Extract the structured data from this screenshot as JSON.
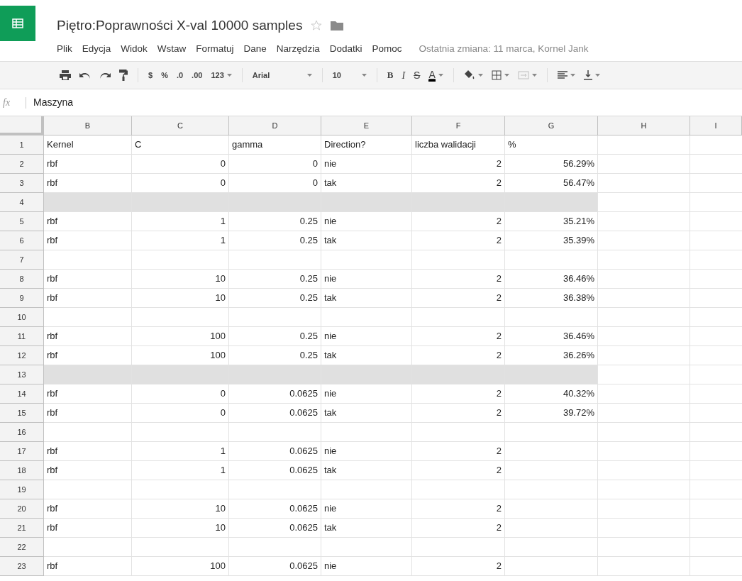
{
  "title": "Piętro:Poprawności X-val 10000 samples",
  "starred": false,
  "menu": [
    "Plik",
    "Edycja",
    "Widok",
    "Wstaw",
    "Formatuj",
    "Dane",
    "Narzędzia",
    "Dodatki",
    "Pomoc"
  ],
  "last_edit": "Ostatnia zmiana: 11 marca, Kornel Jank",
  "toolbar": {
    "currency": "$",
    "percent": "%",
    "decrease_decimals": ".0",
    "increase_decimals": ".00",
    "number_format": "123",
    "font": "Arial",
    "font_size": "10",
    "bold": "B",
    "italic": "I",
    "strikethrough": "S",
    "text_color": "A",
    "merge_disabled": true
  },
  "formula_bar": {
    "label": "fx",
    "value": "Maszyna"
  },
  "columns": [
    "B",
    "C",
    "D",
    "E",
    "F",
    "G",
    "H",
    "I"
  ],
  "rows": [
    {
      "number": "1",
      "kind": "header",
      "shaded": false,
      "cells": {
        "b": "Kernel",
        "c": "C",
        "d": "gamma",
        "e": "Direction?",
        "f": "liczba walidacji",
        "g": "%"
      }
    },
    {
      "number": "2",
      "kind": "data",
      "shaded": false,
      "cells": {
        "b": "rbf",
        "c": "0",
        "d": "0",
        "e": "nie",
        "f": "2",
        "g": "56.29%"
      }
    },
    {
      "number": "3",
      "kind": "data",
      "shaded": false,
      "cells": {
        "b": "rbf",
        "c": "0",
        "d": "0",
        "e": "tak",
        "f": "2",
        "g": "56.47%"
      }
    },
    {
      "number": "4",
      "kind": "data",
      "shaded": true,
      "cells": {}
    },
    {
      "number": "5",
      "kind": "data",
      "shaded": false,
      "cells": {
        "b": "rbf",
        "c": "1",
        "d": "0.25",
        "e": "nie",
        "f": "2",
        "g": "35.21%"
      }
    },
    {
      "number": "6",
      "kind": "data",
      "shaded": false,
      "cells": {
        "b": "rbf",
        "c": "1",
        "d": "0.25",
        "e": "tak",
        "f": "2",
        "g": "35.39%"
      }
    },
    {
      "number": "7",
      "kind": "data",
      "shaded": false,
      "cells": {}
    },
    {
      "number": "8",
      "kind": "data",
      "shaded": false,
      "cells": {
        "b": "rbf",
        "c": "10",
        "d": "0.25",
        "e": "nie",
        "f": "2",
        "g": "36.46%"
      }
    },
    {
      "number": "9",
      "kind": "data",
      "shaded": false,
      "cells": {
        "b": "rbf",
        "c": "10",
        "d": "0.25",
        "e": "tak",
        "f": "2",
        "g": "36.38%"
      }
    },
    {
      "number": "10",
      "kind": "data",
      "shaded": false,
      "cells": {}
    },
    {
      "number": "11",
      "kind": "data",
      "shaded": false,
      "cells": {
        "b": "rbf",
        "c": "100",
        "d": "0.25",
        "e": "nie",
        "f": "2",
        "g": "36.46%"
      }
    },
    {
      "number": "12",
      "kind": "data",
      "shaded": false,
      "cells": {
        "b": "rbf",
        "c": "100",
        "d": "0.25",
        "e": "tak",
        "f": "2",
        "g": "36.26%"
      }
    },
    {
      "number": "13",
      "kind": "data",
      "shaded": true,
      "cells": {}
    },
    {
      "number": "14",
      "kind": "data",
      "shaded": false,
      "cells": {
        "b": "rbf",
        "c": "0",
        "d": "0.0625",
        "e": "nie",
        "f": "2",
        "g": "40.32%"
      }
    },
    {
      "number": "15",
      "kind": "data",
      "shaded": false,
      "cells": {
        "b": "rbf",
        "c": "0",
        "d": "0.0625",
        "e": "tak",
        "f": "2",
        "g": "39.72%"
      }
    },
    {
      "number": "16",
      "kind": "data",
      "shaded": false,
      "cells": {}
    },
    {
      "number": "17",
      "kind": "data",
      "shaded": false,
      "cells": {
        "b": "rbf",
        "c": "1",
        "d": "0.0625",
        "e": "nie",
        "f": "2"
      }
    },
    {
      "number": "18",
      "kind": "data",
      "shaded": false,
      "cells": {
        "b": "rbf",
        "c": "1",
        "d": "0.0625",
        "e": "tak",
        "f": "2"
      }
    },
    {
      "number": "19",
      "kind": "data",
      "shaded": false,
      "cells": {}
    },
    {
      "number": "20",
      "kind": "data",
      "shaded": false,
      "cells": {
        "b": "rbf",
        "c": "10",
        "d": "0.0625",
        "e": "nie",
        "f": "2"
      }
    },
    {
      "number": "21",
      "kind": "data",
      "shaded": false,
      "cells": {
        "b": "rbf",
        "c": "10",
        "d": "0.0625",
        "e": "tak",
        "f": "2"
      }
    },
    {
      "number": "22",
      "kind": "data",
      "shaded": false,
      "cells": {}
    },
    {
      "number": "23",
      "kind": "data",
      "shaded": false,
      "cells": {
        "b": "rbf",
        "c": "100",
        "d": "0.0625",
        "e": "nie",
        "f": "2"
      }
    }
  ]
}
